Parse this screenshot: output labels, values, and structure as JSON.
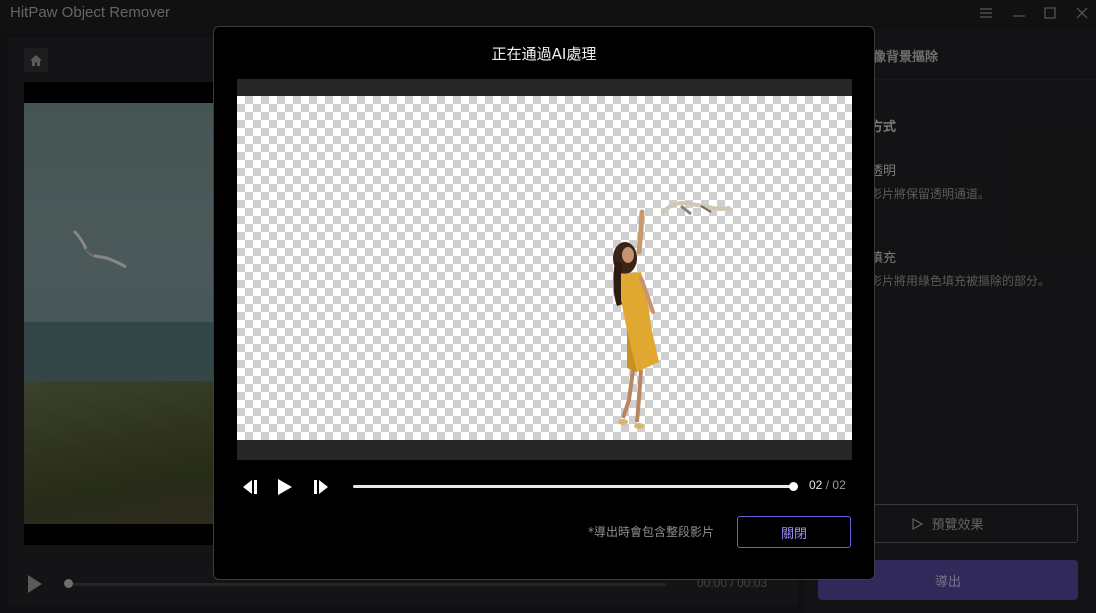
{
  "app": {
    "title": "HitPaw Object Remover",
    "window_controls": [
      "menu-icon",
      "minimize-icon",
      "maximize-icon",
      "close-icon"
    ]
  },
  "editor": {
    "current_time": "00:00",
    "time_separator": "/",
    "total_time": "00:03",
    "progress": 0
  },
  "right_panel": {
    "header": "人像背景摳除",
    "section_title": "方式",
    "option_transparent": {
      "label": "透明",
      "desc": "影片將保留透明通道。"
    },
    "option_fill": {
      "label": "填充",
      "desc": "影片將用綠色填充被摳除的部分。"
    },
    "preview_button": "預覽效果",
    "export_button": "導出"
  },
  "modal": {
    "title": "正在通過AI處理",
    "current_time": "02",
    "time_separator": "/",
    "total_time": "02",
    "progress": 1.0,
    "note": "*導出時會包含整段影片",
    "close_button": "關閉"
  },
  "colors": {
    "accent": "#6b5fd6",
    "export_bg": "#4d3f8c",
    "modal_bg": "#000000"
  }
}
